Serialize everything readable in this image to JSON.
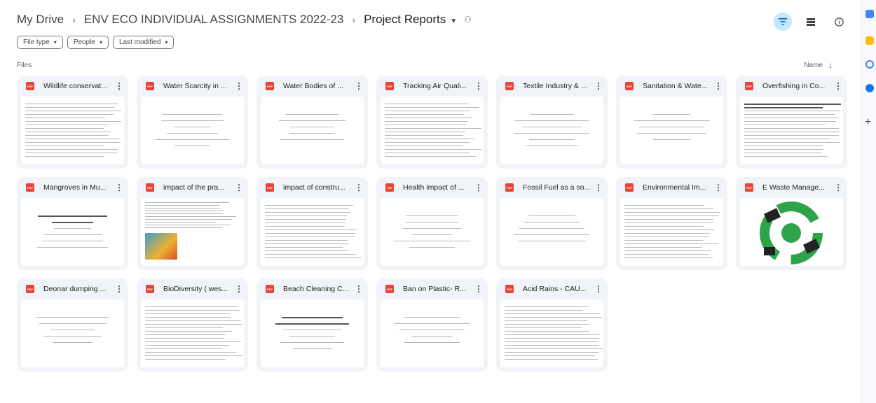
{
  "breadcrumb": {
    "items": [
      "My Drive",
      "ENV ECO INDIVIDUAL ASSIGNMENTS 2022-23",
      "Project Reports"
    ],
    "separator": "›"
  },
  "toolbar": {
    "filter_icon": "filter-icon",
    "view_icon": "list-view-icon",
    "info_icon": "info-icon"
  },
  "filters": [
    "File type",
    "People",
    "Last modified"
  ],
  "section_label": "Files",
  "sort": {
    "label": "Name",
    "direction": "ascending"
  },
  "files": [
    {
      "title": "Wildlife conservat...",
      "type": "pdf"
    },
    {
      "title": "Water Scarcity in ...",
      "type": "pdf"
    },
    {
      "title": "Water Bodies of ...",
      "type": "pdf"
    },
    {
      "title": "Tracking Air Quali...",
      "type": "pdf"
    },
    {
      "title": "Textile Industry & ...",
      "type": "pdf"
    },
    {
      "title": "Sanitation & Wate...",
      "type": "pdf"
    },
    {
      "title": "Overfishing in Co...",
      "type": "pdf"
    },
    {
      "title": "Mangroves in Mu...",
      "type": "pdf"
    },
    {
      "title": "impact of the pra...",
      "type": "pdf"
    },
    {
      "title": "impact of constru...",
      "type": "pdf"
    },
    {
      "title": "Health impact of ...",
      "type": "pdf"
    },
    {
      "title": "Fossil Fuel as a so...",
      "type": "pdf"
    },
    {
      "title": "Environmental Im...",
      "type": "pdf"
    },
    {
      "title": "E Waste Manage...",
      "type": "pdf"
    },
    {
      "title": "Deonar dumping ...",
      "type": "pdf"
    },
    {
      "title": "BioDiversity ( wes...",
      "type": "pdf"
    },
    {
      "title": "Beach Cleaning C...",
      "type": "pdf"
    },
    {
      "title": "Ban on Plastic- R...",
      "type": "pdf"
    },
    {
      "title": "Acid Rains - CAU...",
      "type": "pdf"
    }
  ],
  "file_badge": "PDF",
  "colors": {
    "accent": "#0b57d0",
    "card_bg": "#f0f4f9",
    "pdf_red": "#ea4335",
    "filter_active": "#c2e7ff"
  }
}
